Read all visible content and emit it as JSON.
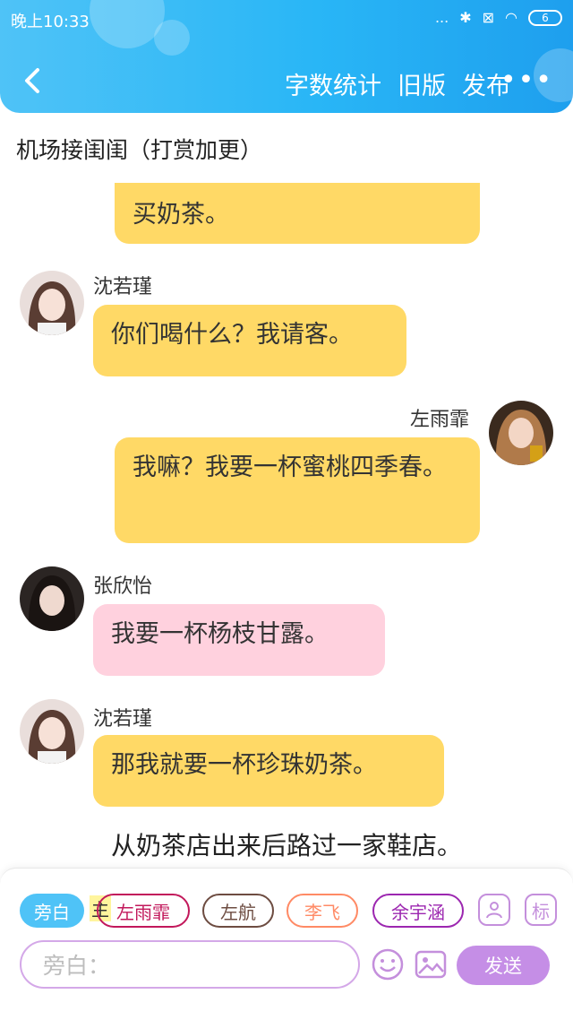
{
  "status_bar": {
    "time": "晚上10:33",
    "signal": "...",
    "bluetooth": "✱",
    "sim": "⊠",
    "wifi": "◠",
    "battery": "6"
  },
  "nav": {
    "back_icon": "back-chevron-icon",
    "actions": [
      "字数统计",
      "旧版",
      "发布"
    ],
    "more": "•••"
  },
  "title": "机场接闺闺（打赏加更）",
  "messages": [
    {
      "side": "right-cut",
      "text": "买奶茶。",
      "color": "yellow"
    },
    {
      "side": "left",
      "name": "沈若瑾",
      "text": "你们喝什么？我请客。",
      "color": "yellow"
    },
    {
      "side": "right",
      "name": "左雨霏",
      "text": "我嘛？我要一杯蜜桃四季春。",
      "color": "yellow"
    },
    {
      "side": "left",
      "name": "张欣怡",
      "text": "我要一杯杨枝甘露。",
      "color": "pink"
    },
    {
      "side": "left",
      "name": "沈若瑾",
      "text": "那我就要一杯珍珠奶茶。",
      "color": "yellow"
    }
  ],
  "narration": "从奶茶店出来后路过一家鞋店。",
  "panel": {
    "chips": [
      "旁白",
      "左雨霏",
      "左航",
      "李飞",
      "余宇涵"
    ],
    "main_tag": "主",
    "tool_icons": [
      "person-card-icon",
      "tag-icon"
    ],
    "tag_label": "标",
    "input_placeholder": "旁白：",
    "emoji_icon": "smiley-icon",
    "image_icon": "image-icon",
    "send_label": "发送"
  },
  "colors": {
    "header": "#29b6f6",
    "bubble_yellow": "#ffd966",
    "bubble_pink": "#ffd1de",
    "accent_purple": "#c58ee6"
  }
}
